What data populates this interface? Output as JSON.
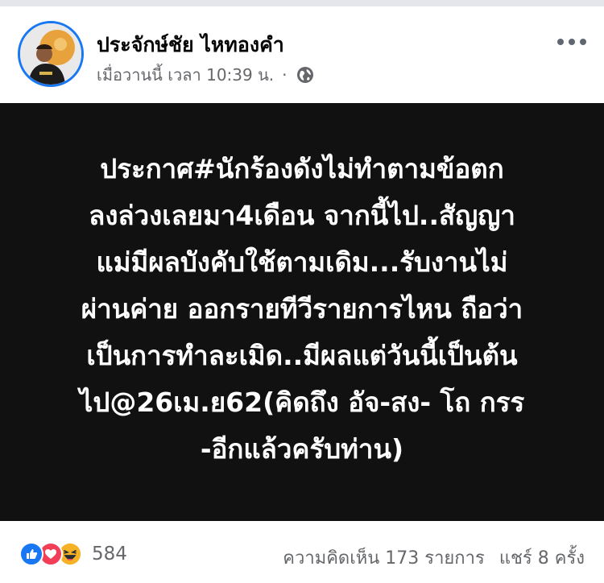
{
  "post": {
    "author": "ประจักษ์ชัย ไหทองคำ",
    "timestamp": "เมื่อวานนี้ เวลา 10:39 น.",
    "separator": "·",
    "lines": [
      "ประกาศ#นักร้องดังไม่ทำตามข้อตก",
      "ลงล่วงเลยมา4เดือน จากนี้ไป..สัญญา",
      "แม่มีผลบังคับใช้ตามเดิม...รับงานไม่",
      "ผ่านค่าย ออกรายทีวีรายการไหน ถือว่า",
      "เป็นการทำละเมิด..มีผลแต่วันนี้เป็นต้น",
      "ไป@26เม.ย62(คิดถึง อัจ-สง- โถ กรร",
      "-อีกแล้วครับท่าน)"
    ],
    "background_color": "#111111",
    "text_color": "#ffffff"
  },
  "footer": {
    "reaction_count": "584",
    "comments": "ความคิดเห็น 173 รายการ",
    "shares": "แชร์ 8 ครั้ง",
    "reactions": [
      "like-icon",
      "love-icon",
      "haha-icon"
    ]
  },
  "colors": {
    "accent": "#1877f2",
    "secondary_text": "#65676b"
  }
}
